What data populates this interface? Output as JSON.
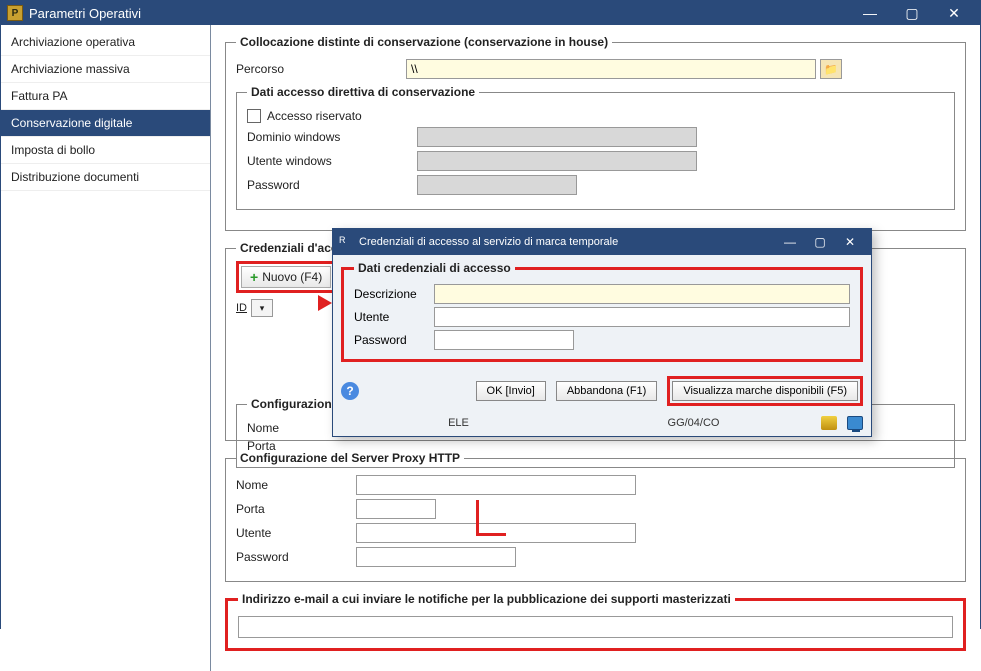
{
  "window": {
    "title": "Parametri Operativi",
    "icon_letter": "P"
  },
  "sidebar": {
    "items": [
      {
        "label": "Archiviazione operativa"
      },
      {
        "label": "Archiviazione massiva"
      },
      {
        "label": "Fattura PA"
      },
      {
        "label": "Conservazione digitale"
      },
      {
        "label": "Imposta di bollo"
      },
      {
        "label": "Distribuzione documenti"
      }
    ],
    "selected_index": 3
  },
  "collocazione": {
    "legend": "Collocazione distinte di conservazione (conservazione in house)",
    "percorso_label": "Percorso",
    "percorso_value": "\\\\",
    "dati_accesso_legend": "Dati accesso direttiva di conservazione",
    "accesso_riservato_label": "Accesso riservato",
    "dominio_label": "Dominio windows",
    "utente_label": "Utente windows",
    "password_label": "Password"
  },
  "credenziali": {
    "legend": "Credenziali d'accesso al servizio fornitura marche temporali",
    "nuovo_label": "Nuovo (F4)",
    "id_label": "ID"
  },
  "dialog": {
    "title": "Credenziali di accesso al servizio di marca temporale",
    "icon_letter": "R",
    "fieldset_legend": "Dati credenziali di accesso",
    "descrizione_label": "Descrizione",
    "utente_label": "Utente",
    "password_label": "Password",
    "ok_label": "OK [Invio]",
    "abbandona_label": "Abbandona (F1)",
    "visualizza_label": "Visualizza marche disponibili (F5)",
    "footer_col1": "ELE",
    "footer_col2": "GG/04/CO"
  },
  "config_server": {
    "legend_visible_prefix": "Configurazione",
    "nome_label": "Nome",
    "porta_label": "Porta"
  },
  "proxy": {
    "legend": "Configurazione del Server Proxy HTTP",
    "nome_label": "Nome",
    "porta_label": "Porta",
    "utente_label": "Utente",
    "password_label": "Password"
  },
  "email_section": {
    "legend": "Indirizzo e-mail a cui inviare le notifiche per la pubblicazione dei supporti masterizzati",
    "value": ""
  }
}
